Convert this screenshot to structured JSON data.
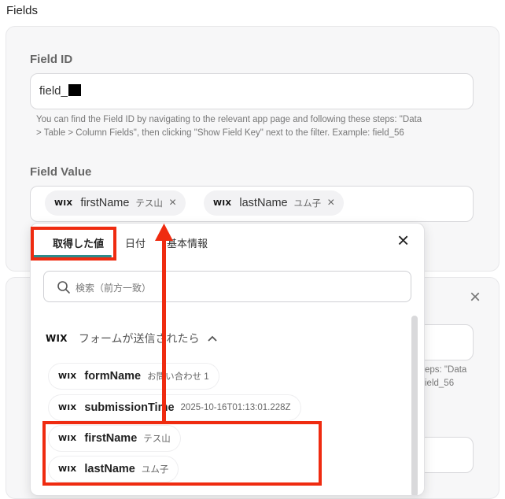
{
  "section": {
    "title": "Fields"
  },
  "field_id": {
    "label": "Field ID",
    "value": "field_",
    "help_line1": "You can find the Field ID by navigating to the relevant app page and following these steps: \"Data",
    "help_line2": "> Table > Column Fields\", then clicking \"Show Field Key\" next to the filter. Example: field_56"
  },
  "field_value": {
    "label": "Field Value",
    "tokens": [
      {
        "source": "WIX",
        "name": "firstName",
        "value": "テス山"
      },
      {
        "source": "WIX",
        "name": "lastName",
        "value": "ユム子"
      }
    ],
    "remove_icon": "×"
  },
  "card2_peek": {
    "help_a": "eps: \"Data",
    "help_b": "ield_56",
    "close_icon": "×"
  },
  "dropdown": {
    "tabs": [
      {
        "label": "取得した値",
        "active": true
      },
      {
        "label": "日付",
        "active": false
      },
      {
        "label": "基本情報",
        "active": false
      }
    ],
    "close_icon": "×",
    "search_placeholder": "検索（前方一致）",
    "group": {
      "source": "WIX",
      "title": "フォームが送信されたら",
      "chevron": "^"
    },
    "items": [
      {
        "source": "WIX",
        "name": "formName",
        "value": "お問い合わせ 1"
      },
      {
        "source": "WIX",
        "name": "submissionTime",
        "value": "2025-10-16T01:13:01.228Z"
      },
      {
        "source": "WIX",
        "name": "firstName",
        "value": "テス山"
      },
      {
        "source": "WIX",
        "name": "lastName",
        "value": "ユム子"
      }
    ]
  },
  "annotation_color": "#ef2b10"
}
